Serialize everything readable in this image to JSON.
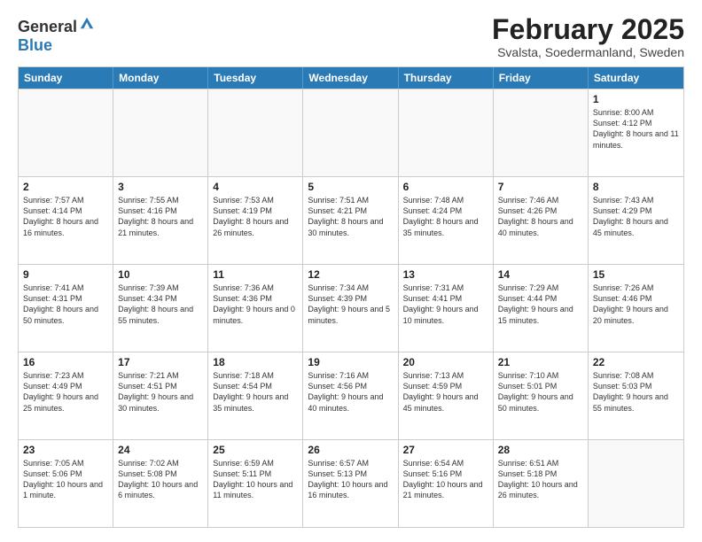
{
  "header": {
    "logo_line1": "General",
    "logo_line2": "Blue",
    "title": "February 2025",
    "subtitle": "Svalsta, Soedermanland, Sweden"
  },
  "days_of_week": [
    "Sunday",
    "Monday",
    "Tuesday",
    "Wednesday",
    "Thursday",
    "Friday",
    "Saturday"
  ],
  "weeks": [
    [
      {
        "day": "",
        "info": ""
      },
      {
        "day": "",
        "info": ""
      },
      {
        "day": "",
        "info": ""
      },
      {
        "day": "",
        "info": ""
      },
      {
        "day": "",
        "info": ""
      },
      {
        "day": "",
        "info": ""
      },
      {
        "day": "1",
        "info": "Sunrise: 8:00 AM\nSunset: 4:12 PM\nDaylight: 8 hours and 11 minutes."
      }
    ],
    [
      {
        "day": "2",
        "info": "Sunrise: 7:57 AM\nSunset: 4:14 PM\nDaylight: 8 hours and 16 minutes."
      },
      {
        "day": "3",
        "info": "Sunrise: 7:55 AM\nSunset: 4:16 PM\nDaylight: 8 hours and 21 minutes."
      },
      {
        "day": "4",
        "info": "Sunrise: 7:53 AM\nSunset: 4:19 PM\nDaylight: 8 hours and 26 minutes."
      },
      {
        "day": "5",
        "info": "Sunrise: 7:51 AM\nSunset: 4:21 PM\nDaylight: 8 hours and 30 minutes."
      },
      {
        "day": "6",
        "info": "Sunrise: 7:48 AM\nSunset: 4:24 PM\nDaylight: 8 hours and 35 minutes."
      },
      {
        "day": "7",
        "info": "Sunrise: 7:46 AM\nSunset: 4:26 PM\nDaylight: 8 hours and 40 minutes."
      },
      {
        "day": "8",
        "info": "Sunrise: 7:43 AM\nSunset: 4:29 PM\nDaylight: 8 hours and 45 minutes."
      }
    ],
    [
      {
        "day": "9",
        "info": "Sunrise: 7:41 AM\nSunset: 4:31 PM\nDaylight: 8 hours and 50 minutes."
      },
      {
        "day": "10",
        "info": "Sunrise: 7:39 AM\nSunset: 4:34 PM\nDaylight: 8 hours and 55 minutes."
      },
      {
        "day": "11",
        "info": "Sunrise: 7:36 AM\nSunset: 4:36 PM\nDaylight: 9 hours and 0 minutes."
      },
      {
        "day": "12",
        "info": "Sunrise: 7:34 AM\nSunset: 4:39 PM\nDaylight: 9 hours and 5 minutes."
      },
      {
        "day": "13",
        "info": "Sunrise: 7:31 AM\nSunset: 4:41 PM\nDaylight: 9 hours and 10 minutes."
      },
      {
        "day": "14",
        "info": "Sunrise: 7:29 AM\nSunset: 4:44 PM\nDaylight: 9 hours and 15 minutes."
      },
      {
        "day": "15",
        "info": "Sunrise: 7:26 AM\nSunset: 4:46 PM\nDaylight: 9 hours and 20 minutes."
      }
    ],
    [
      {
        "day": "16",
        "info": "Sunrise: 7:23 AM\nSunset: 4:49 PM\nDaylight: 9 hours and 25 minutes."
      },
      {
        "day": "17",
        "info": "Sunrise: 7:21 AM\nSunset: 4:51 PM\nDaylight: 9 hours and 30 minutes."
      },
      {
        "day": "18",
        "info": "Sunrise: 7:18 AM\nSunset: 4:54 PM\nDaylight: 9 hours and 35 minutes."
      },
      {
        "day": "19",
        "info": "Sunrise: 7:16 AM\nSunset: 4:56 PM\nDaylight: 9 hours and 40 minutes."
      },
      {
        "day": "20",
        "info": "Sunrise: 7:13 AM\nSunset: 4:59 PM\nDaylight: 9 hours and 45 minutes."
      },
      {
        "day": "21",
        "info": "Sunrise: 7:10 AM\nSunset: 5:01 PM\nDaylight: 9 hours and 50 minutes."
      },
      {
        "day": "22",
        "info": "Sunrise: 7:08 AM\nSunset: 5:03 PM\nDaylight: 9 hours and 55 minutes."
      }
    ],
    [
      {
        "day": "23",
        "info": "Sunrise: 7:05 AM\nSunset: 5:06 PM\nDaylight: 10 hours and 1 minute."
      },
      {
        "day": "24",
        "info": "Sunrise: 7:02 AM\nSunset: 5:08 PM\nDaylight: 10 hours and 6 minutes."
      },
      {
        "day": "25",
        "info": "Sunrise: 6:59 AM\nSunset: 5:11 PM\nDaylight: 10 hours and 11 minutes."
      },
      {
        "day": "26",
        "info": "Sunrise: 6:57 AM\nSunset: 5:13 PM\nDaylight: 10 hours and 16 minutes."
      },
      {
        "day": "27",
        "info": "Sunrise: 6:54 AM\nSunset: 5:16 PM\nDaylight: 10 hours and 21 minutes."
      },
      {
        "day": "28",
        "info": "Sunrise: 6:51 AM\nSunset: 5:18 PM\nDaylight: 10 hours and 26 minutes."
      },
      {
        "day": "",
        "info": ""
      }
    ]
  ]
}
